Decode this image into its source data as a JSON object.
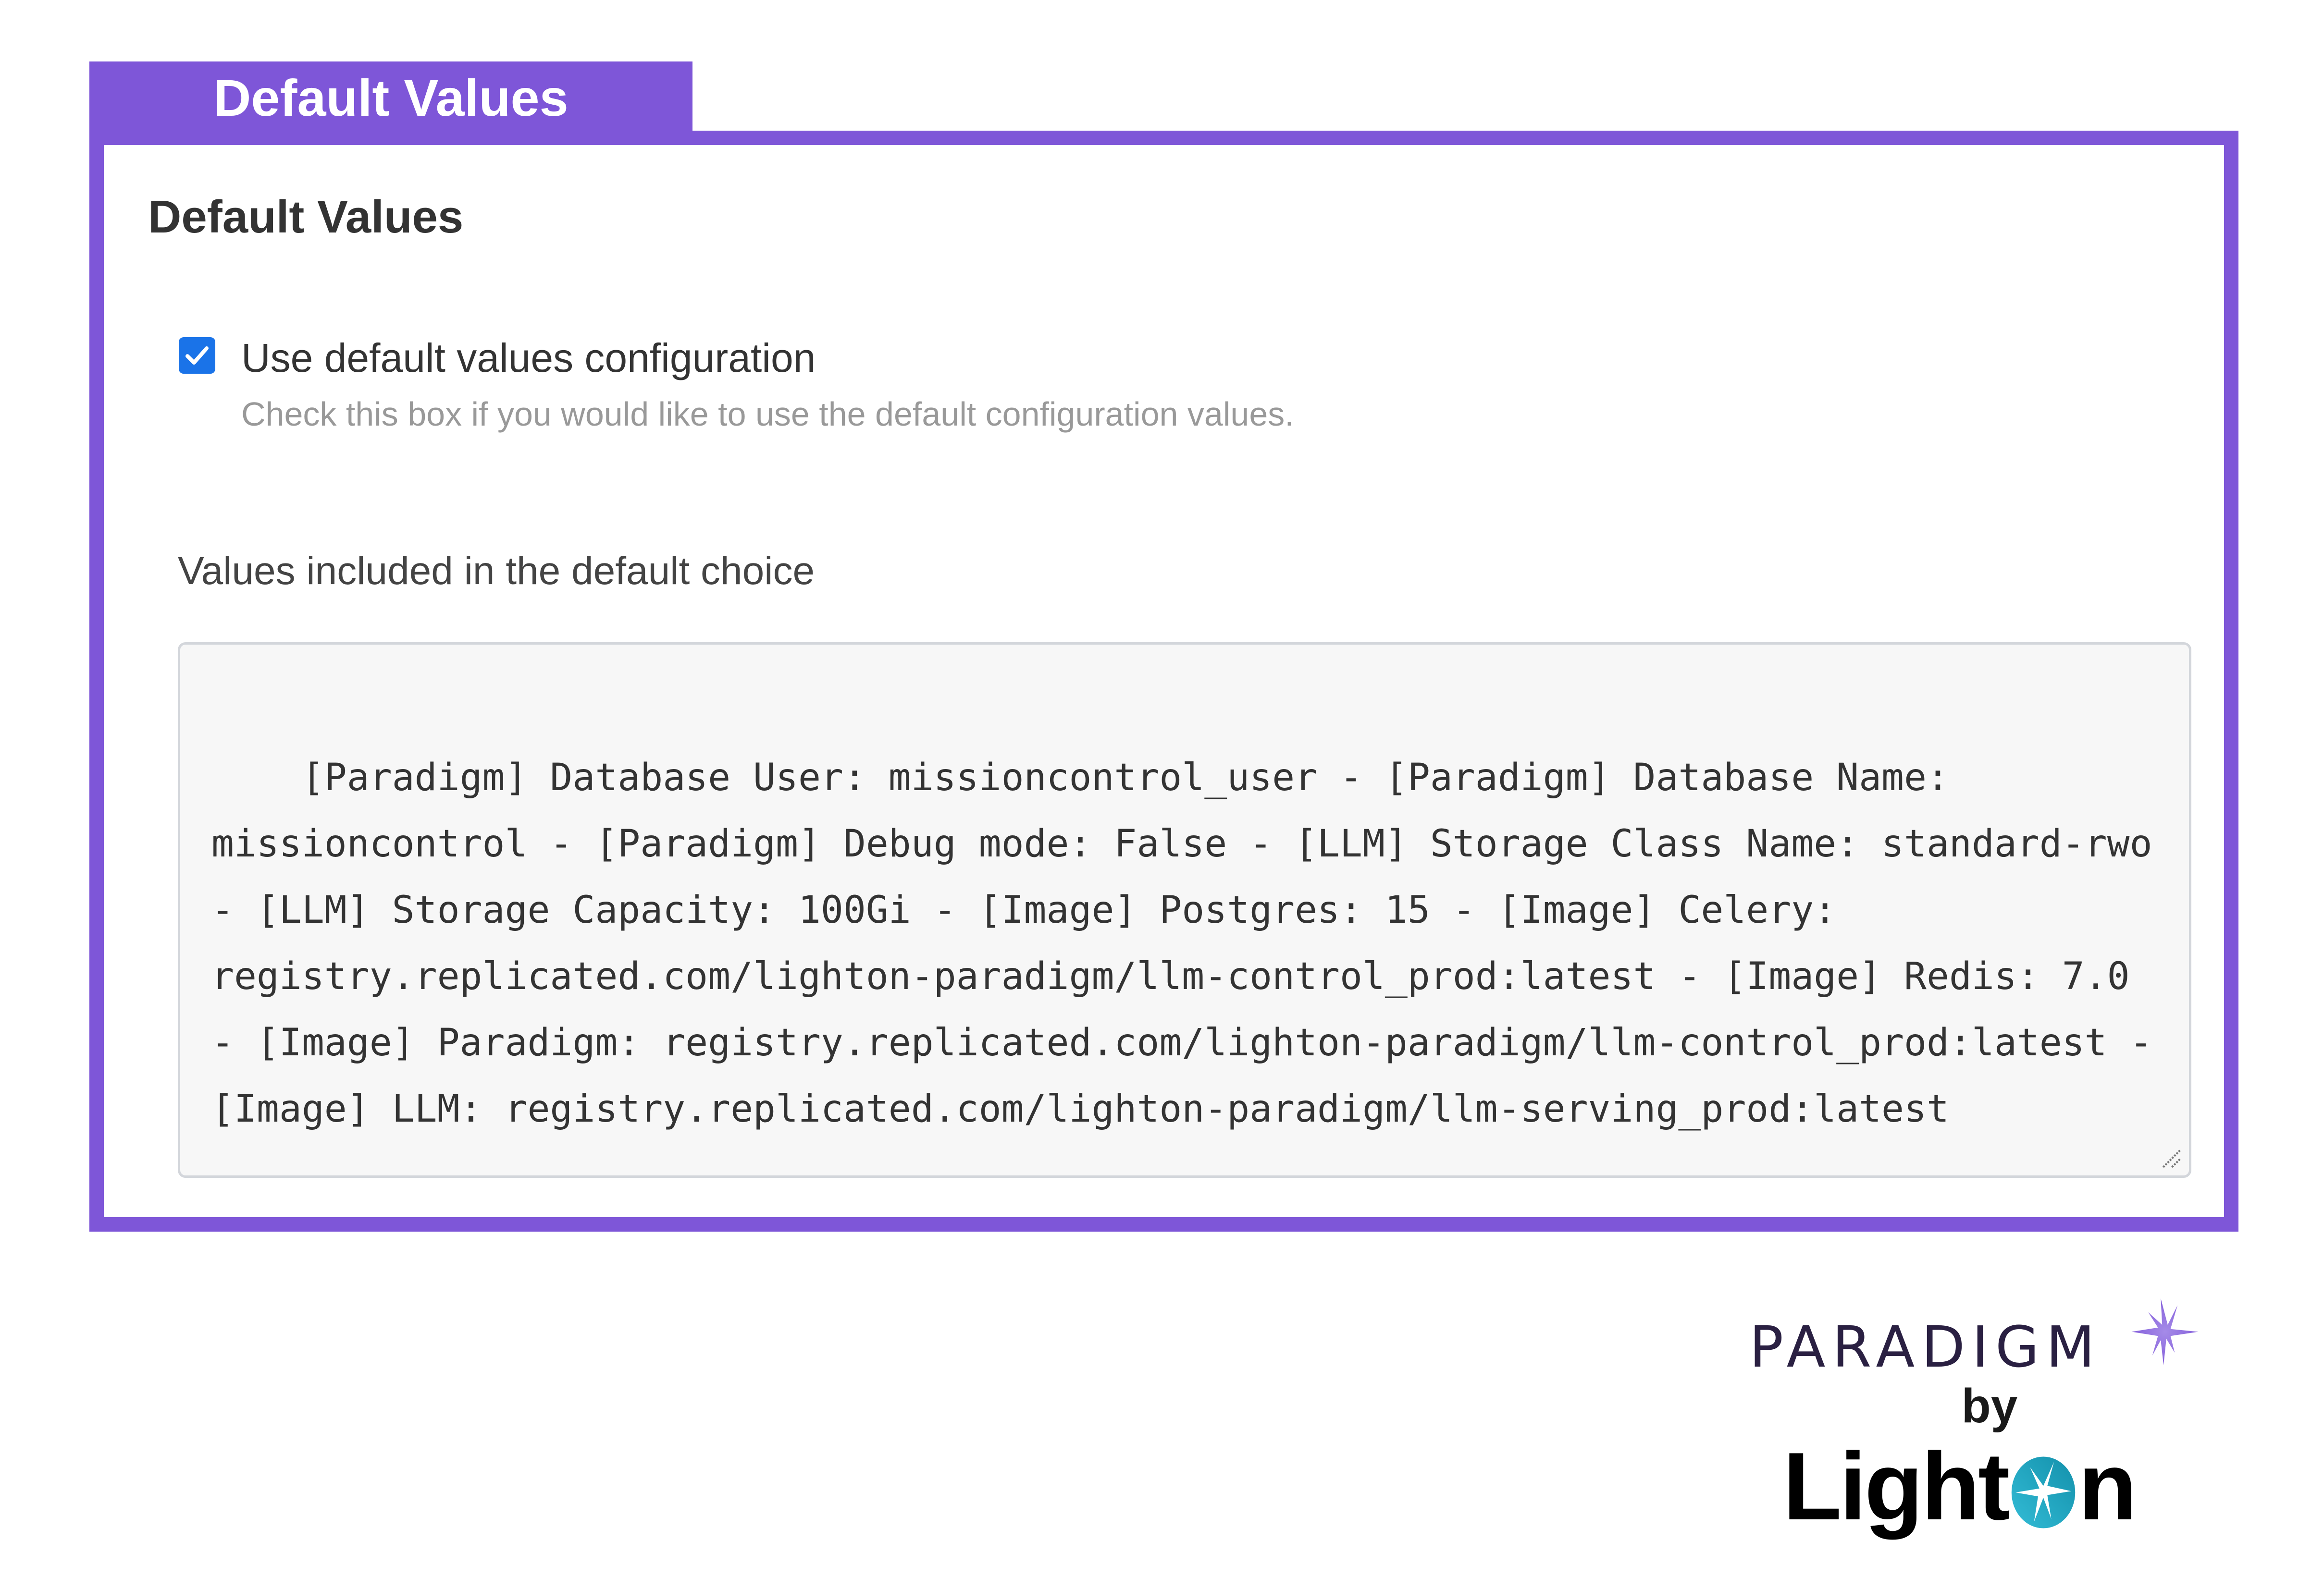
{
  "header": {
    "tab_title": "Default Values"
  },
  "section": {
    "title": "Default Values",
    "checkbox": {
      "label": "Use default values configuration",
      "help_text": "Check this box if you would like to use the default configuration values.",
      "checked": true
    },
    "values_label": "Values included in the default choice",
    "values_text": "[Paradigm] Database User: missioncontrol_user - [Paradigm] Database Name: missioncontrol - [Paradigm] Debug mode: False - [LLM] Storage Class Name: standard-rwo - [LLM] Storage Capacity: 100Gi - [Image] Postgres: 15 - [Image] Celery: registry.replicated.com/lighton-paradigm/llm-control_prod:latest - [Image] Redis: 7.0 - [Image] Paradigm: registry.replicated.com/lighton-paradigm/llm-control_prod:latest - [Image] LLM: registry.replicated.com/lighton-paradigm/llm-serving_prod:latest"
  },
  "branding": {
    "product": "PARADIGM",
    "by": "by",
    "company_prefix": "Light",
    "company_suffix": "n"
  },
  "colors": {
    "accent": "#7e56d8",
    "checkbox": "#1a73e8",
    "lighton_teal": "#1fa9c6",
    "paradigm_text": "#2a2042"
  }
}
